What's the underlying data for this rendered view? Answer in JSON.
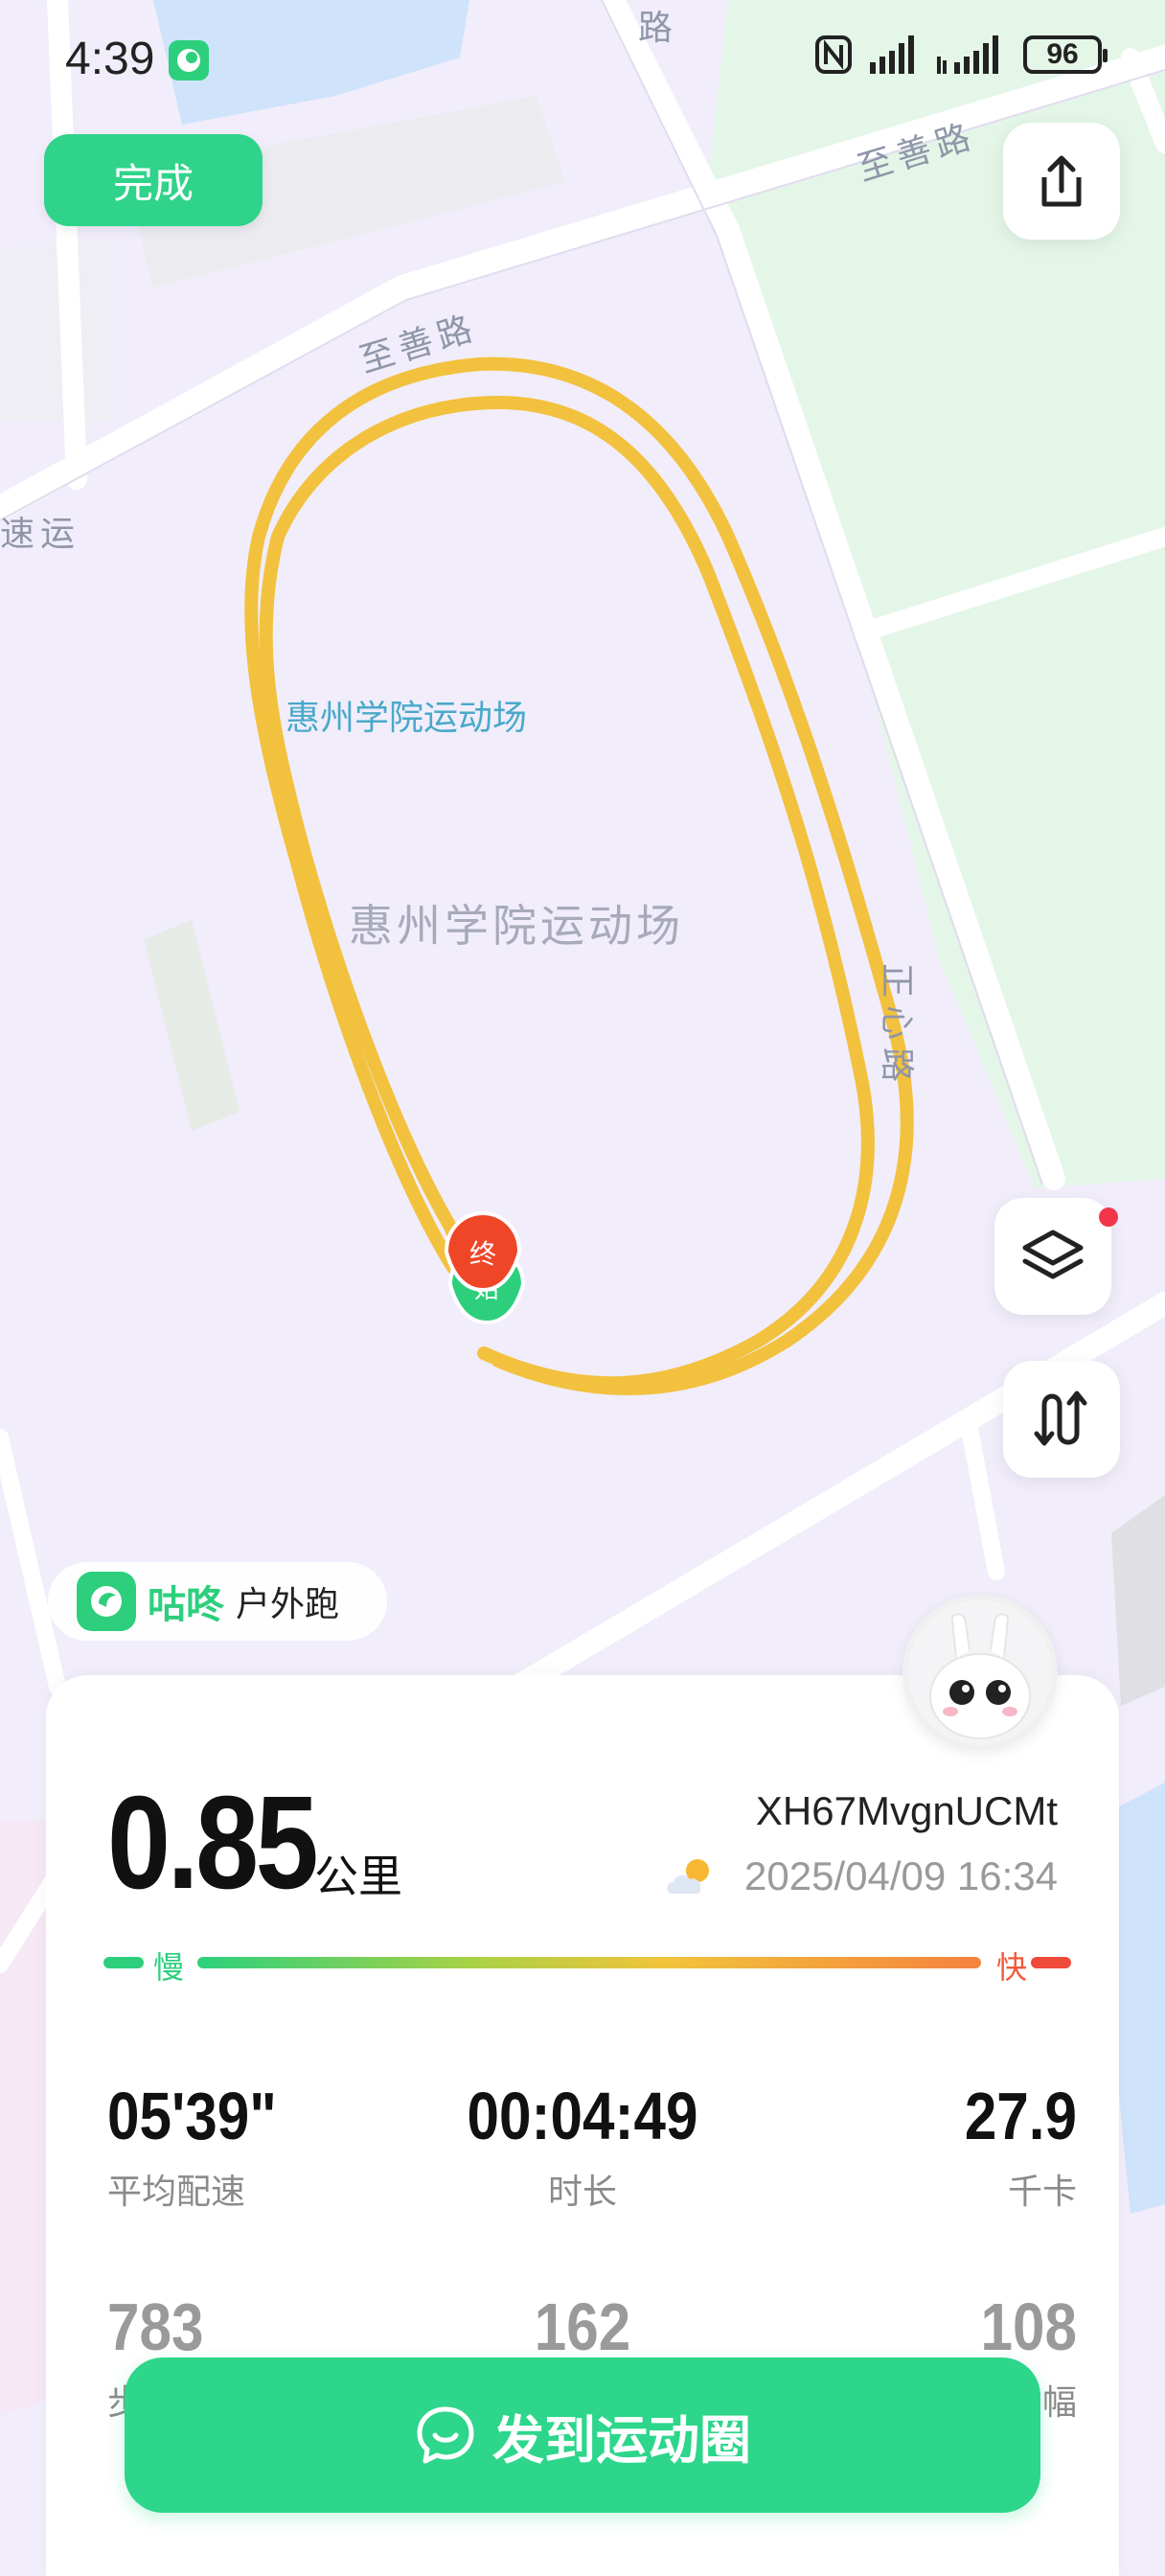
{
  "status_bar": {
    "time": "4:39",
    "battery": "96",
    "icons": [
      "app-notification-icon",
      "nfc-icon",
      "signal-icon",
      "signal-hd-icon",
      "battery-icon"
    ]
  },
  "top": {
    "done_label": "完成",
    "share_icon": "share-icon"
  },
  "map": {
    "road_labels": [
      "路",
      "至善路",
      "至善路",
      "速运",
      "正心路"
    ],
    "poi_label": "惠州学院运动场",
    "area_label": "惠州学院运动场",
    "start_marker": "始",
    "end_marker": "终",
    "route_color": "#F2C13E"
  },
  "side_controls": {
    "layers_icon": "layers-icon",
    "route_icon": "route-wave-icon"
  },
  "brand": {
    "name": "咕咚",
    "activity": "户外跑"
  },
  "summary": {
    "distance": "0.85",
    "distance_unit": "公里",
    "user_id": "XH67MvgnUCMt",
    "datetime": "2025/04/09 16:34",
    "weather_icon": "partly-cloudy-icon",
    "pace_slow": "慢",
    "pace_fast": "快"
  },
  "metrics": {
    "pace": {
      "value": "05'39\"",
      "label": "平均配速"
    },
    "duration": {
      "value": "00:04:49",
      "label": "时长"
    },
    "calories": {
      "value": "27.9",
      "label": "千卡"
    },
    "steps": {
      "value": "783",
      "label": "步"
    },
    "cadence": {
      "value": "162",
      "label": ""
    },
    "stride": {
      "value": "108",
      "label": "幅"
    }
  },
  "post_button": {
    "label": "发到运动圈",
    "icon": "chat-bubble-icon"
  }
}
